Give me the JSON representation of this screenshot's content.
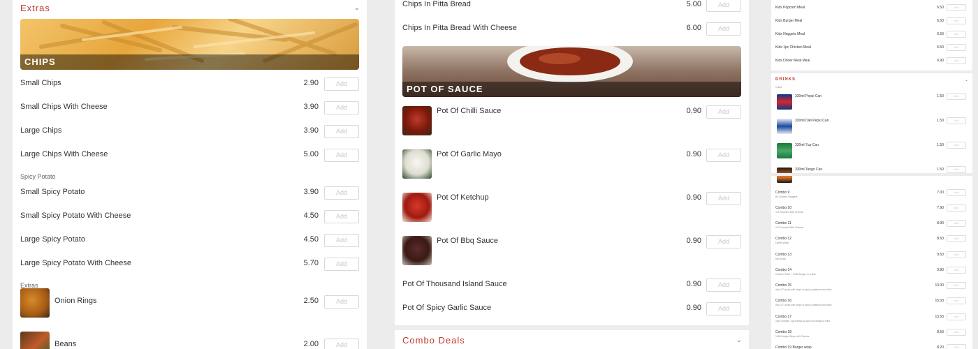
{
  "left": {
    "section_title": "Extras",
    "banner_label": "CHIPS",
    "items": [
      {
        "name": "Small Chips",
        "price": "2.90"
      },
      {
        "name": "Small Chips With Cheese",
        "price": "3.90"
      },
      {
        "name": "Large Chips",
        "price": "3.90"
      },
      {
        "name": "Large Chips With Cheese",
        "price": "5.00"
      }
    ],
    "subhead_spicy": "Spicy Potato",
    "spicy_items": [
      {
        "name": "Small Spicy Potato",
        "price": "3.90"
      },
      {
        "name": "Small Spicy Potato With Cheese",
        "price": "4.50"
      },
      {
        "name": "Large Spicy Potato",
        "price": "4.50"
      },
      {
        "name": "Large Spicy Potato With Cheese",
        "price": "5.70"
      }
    ],
    "subhead_extras": "Extras",
    "extra_items": [
      {
        "name": "Onion Rings",
        "price": "2.50"
      },
      {
        "name": "Beans",
        "price": "2.00"
      }
    ],
    "add_label": "Add"
  },
  "middle": {
    "top_items": [
      {
        "name": "Chips In Pitta Bread",
        "price": "5.00"
      },
      {
        "name": "Chips In Pitta Bread With Cheese",
        "price": "6.00"
      }
    ],
    "banner_label": "POT OF SAUCE",
    "sauce_items": [
      {
        "name": "Pot Of Chilli Sauce",
        "price": "0.90"
      },
      {
        "name": "Pot Of Garlic Mayo",
        "price": "0.90"
      },
      {
        "name": "Pot Of Ketchup",
        "price": "0.90"
      },
      {
        "name": "Pot Of Bbq Sauce",
        "price": "0.90"
      },
      {
        "name": "Pot Of Thousand Island Sauce",
        "price": "0.90"
      },
      {
        "name": "Pot Of Spicy Garlic Sauce",
        "price": "0.90"
      }
    ],
    "combo_title": "Combo Deals",
    "add_label": "Add"
  },
  "right": {
    "kids_items": [
      {
        "name": "Kids Popcorn Meal",
        "price": "6.50"
      },
      {
        "name": "Kids Burger Meal",
        "price": "6.50"
      },
      {
        "name": "Kids Nuggets Meal",
        "price": "6.50"
      },
      {
        "name": "Kids 1pc Chicken Meal",
        "price": "6.50"
      },
      {
        "name": "Kids Doner Meat Meal",
        "price": "6.90"
      }
    ],
    "drinks_title": "DRINKS",
    "drinks_sub": "Cans",
    "drinks": [
      {
        "name": "330ml Pepsi Can",
        "price": "1.50"
      },
      {
        "name": "330ml Diet Pepsi Can",
        "price": "1.50"
      },
      {
        "name": "330ml 7up Can",
        "price": "1.50"
      },
      {
        "name": "330ml Tango Can",
        "price": "1.50"
      }
    ],
    "combos": [
      {
        "name": "Combo 9",
        "desc": "8x Chicken Nuggets",
        "price": "7.00"
      },
      {
        "name": "Combo 10",
        "desc": "1/4 Pounder With Cheese",
        "price": "7.90"
      },
      {
        "name": "Combo 11",
        "desc": "1/2 Pounder With Cheese",
        "price": "8.90"
      },
      {
        "name": "Combo 12",
        "desc": "Doner Wrap",
        "price": "8.50"
      },
      {
        "name": "Combo 13",
        "desc": "Mix Wrap",
        "price": "9.50"
      },
      {
        "name": "Combo 14",
        "desc": "Chicken Fillet + 1/4lb Burger in a Bun",
        "price": "9.80"
      },
      {
        "name": "Combo 15",
        "desc": "Any 10\" pizza with chips or spicy potatoes and drink",
        "price": "13.00"
      },
      {
        "name": "Combo 16",
        "desc": "Any 12\" pizza with chips or spicy potatoes and drink",
        "price": "15.00"
      },
      {
        "name": "Combo 17",
        "desc": "2pcs chicken, 3pcs strips & 4pcs hot wings & drink",
        "price": "13.50"
      },
      {
        "name": "Combo 18",
        "desc": "1/4lb Burger Wrap with Cheese",
        "price": "8.50"
      },
      {
        "name": "Combo 19 Burger wrap",
        "desc": "",
        "price": "8.20"
      }
    ],
    "add_label": "Add"
  },
  "colors": {
    "accent": "#c0392b",
    "bg": "#ececec"
  }
}
